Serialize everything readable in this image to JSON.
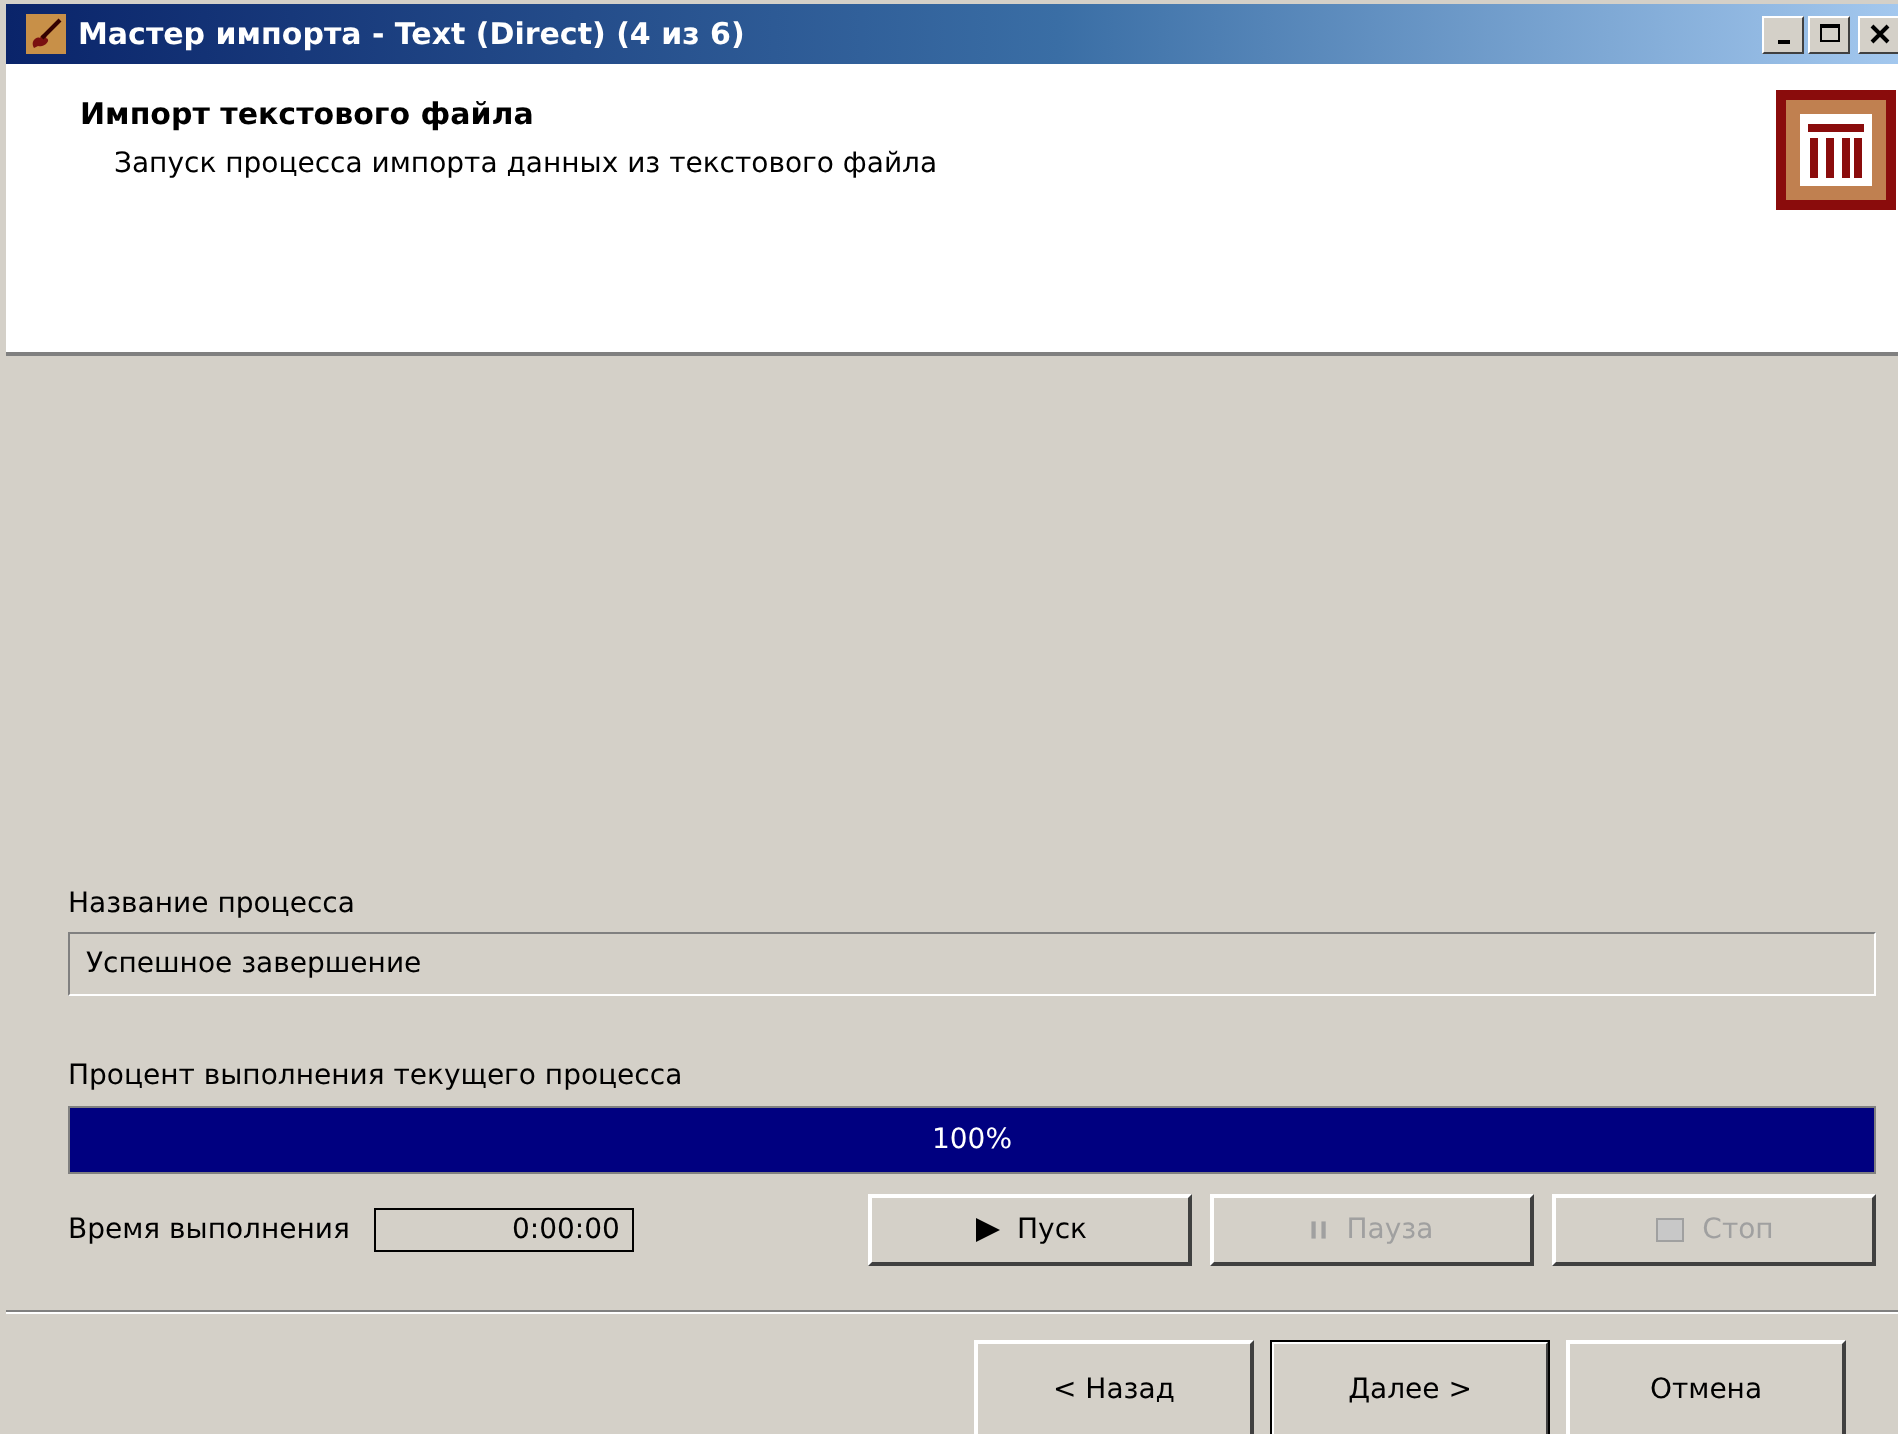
{
  "window": {
    "title": "Мастер импорта - Text (Direct) (4 из 6)"
  },
  "header": {
    "title": "Импорт текстового файла",
    "subtitle": "Запуск процесса импорта данных из текстового файла"
  },
  "process_name": {
    "label": "Название процесса",
    "value": "Успешное завершение"
  },
  "progress": {
    "label": "Процент выполнения текущего процесса",
    "level": 1,
    "reading": "100%"
  },
  "elapsed": {
    "label": "Время выполнения",
    "value": "0:00:00"
  },
  "controls": [
    {
      "kind": "play",
      "label": "Пуск",
      "disabled": false
    },
    {
      "kind": "pause",
      "label": "Пауза",
      "disabled": true
    },
    {
      "kind": "stop",
      "label": "Стоп",
      "disabled": true
    }
  ],
  "nav_buttons": [
    {
      "label": "< Назад",
      "default": false
    },
    {
      "label": "Далее >",
      "default": true
    },
    {
      "label": "Отмена",
      "default": false
    }
  ]
}
